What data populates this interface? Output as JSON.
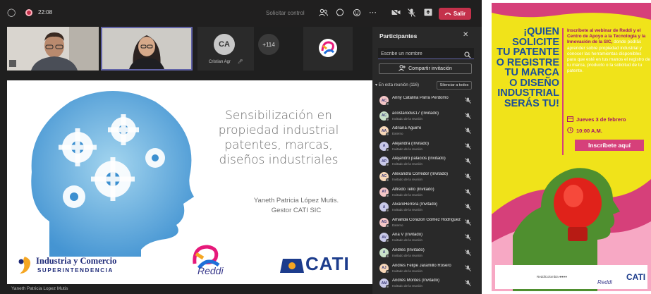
{
  "topbar": {
    "timer": "22:08",
    "request_control": "Solicitar control",
    "leave_label": "Salir",
    "accent": "#c4314b"
  },
  "video_strip": {
    "ca_initials": "CA",
    "ca_name": "Cristian Agr",
    "more_count": "+114"
  },
  "slide": {
    "title_lines": [
      "Sensibilización en",
      "propiedad industrial",
      "patentes, marcas,",
      "diseños industriales"
    ],
    "presenter_name": "Yaneth Patricia López Mutis.",
    "presenter_role": "Gestor CATI SIC",
    "sic_name": "Industria y Comercio",
    "sic_sub": "SUPERINTENDENCIA",
    "reddi": "Reddi",
    "cati": "CATI"
  },
  "presenter_caption": "Yaneth Patricia Lopez Mutis",
  "participants": {
    "title": "Participantes",
    "search_placeholder": "Escribe un nombre",
    "invite_label": "Compartir invitación",
    "meeting_label": "En esta reunión (116)",
    "silence_label": "Silenciar a todos",
    "items": [
      {
        "initials": "AC",
        "name": "Anny Catalina Parra Perdomo",
        "role": "",
        "avatar_color": "#f4c6c6"
      },
      {
        "initials": "AC",
        "name": "acostarodus17 (Invitado)",
        "role": "Invitado de la reunión",
        "avatar_color": "#c9e2c9"
      },
      {
        "initials": "AA",
        "name": "Adriana Aguirre",
        "role": "Externo",
        "avatar_color": "#f7d7b8"
      },
      {
        "initials": "A",
        "name": "Alejandra (Invitado)",
        "role": "Invitado de la reunión",
        "avatar_color": "#c9c9e8"
      },
      {
        "initials": "AP",
        "name": "Alejandro palacios (Invitado)",
        "role": "Invitado de la reunión",
        "avatar_color": "#c9c9e8"
      },
      {
        "initials": "AC",
        "name": "Alexandra Corredor (Invitado)",
        "role": "Invitado de la reunión",
        "avatar_color": "#f7d7b8"
      },
      {
        "initials": "AT",
        "name": "Alfredo Tello (Invitado)",
        "role": "Invitado de la reunión",
        "avatar_color": "#f4c6c6"
      },
      {
        "initials": "A",
        "name": "AlvaroHerrera (Invitado)",
        "role": "Invitado de la reunión",
        "avatar_color": "#c9c9e8"
      },
      {
        "initials": "AG",
        "name": "Amanda Corazon Gómez Rodríguez",
        "role": "Externo",
        "avatar_color": "#f4c6c6"
      },
      {
        "initials": "AV",
        "name": "Ana V (Invitado)",
        "role": "Invitado de la reunión",
        "avatar_color": "#c9c9e8"
      },
      {
        "initials": "A",
        "name": "Andres (Invitado)",
        "role": "Invitado de la reunión",
        "avatar_color": "#c9e2c9"
      },
      {
        "initials": "AJ",
        "name": "Andres Felipe Jaramillo Rosero",
        "role": "Invitado de la reunión",
        "avatar_color": "#f7d7b8"
      },
      {
        "initials": "AM",
        "name": "Andrés Montes (Invitado)",
        "role": "Invitado de la reunión",
        "avatar_color": "#c9c9e8"
      }
    ]
  },
  "poster": {
    "question_lines": [
      "¡QUIEN",
      "SOLICITE",
      "TU PATENTE",
      "O REGISTRE",
      "TU MARCA",
      "O DISEÑO",
      "INDUSTRIAL",
      "SERÁS TU!"
    ],
    "invite_text": "Inscríbete al webinar de Reddi y el Centro de Apoyo a la Tecnología y la Innovación de la SIC,",
    "desc_text": "donde podrás aprender sobre propiedad industrial y conocer las herramientas disponibles para que esté en tus manos el registro de tu marca, producto o la solicitud de tu patente.",
    "date": "Jueves 3 de febrero",
    "time": "10:00 A.M.",
    "cta": "Inscríbete aquí",
    "social": "ReddiColombia",
    "reddi": "Reddi",
    "cati": "CATI",
    "colors": {
      "background": "#f0e31a",
      "blue": "#1a4f9c",
      "magenta": "#d6407a"
    }
  }
}
